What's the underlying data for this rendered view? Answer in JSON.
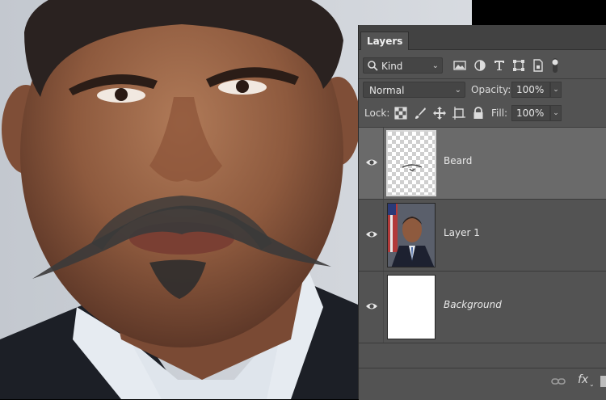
{
  "panel": {
    "tab_label": "Layers",
    "filter": {
      "value": "Kind",
      "icon": "search-icon"
    },
    "filter_icons": [
      "image-filter-icon",
      "adjustment-filter-icon",
      "type-filter-icon",
      "shape-filter-icon",
      "smart-object-filter-icon",
      "toggle-filter-icon"
    ],
    "blend_mode": "Normal",
    "opacity_label": "Opacity:",
    "opacity_value": "100%",
    "lock_label": "Lock:",
    "lock_icons": [
      "lock-transparent-icon",
      "lock-paint-icon",
      "lock-position-icon",
      "lock-artboard-icon",
      "lock-all-icon"
    ],
    "fill_label": "Fill:",
    "fill_value": "100%"
  },
  "layers": [
    {
      "name": "Beard",
      "selected": true,
      "visible": true,
      "italic": false,
      "thumb": "transparent-beard"
    },
    {
      "name": "Layer 1",
      "selected": false,
      "visible": true,
      "italic": false,
      "thumb": "portrait"
    },
    {
      "name": "Background",
      "selected": false,
      "visible": true,
      "italic": true,
      "thumb": "white"
    }
  ],
  "bottom_bar": {
    "icons": [
      "link-layers-icon",
      "fx-icon"
    ],
    "fx_label": "fx"
  },
  "colors": {
    "panel_bg": "#535353",
    "selected_row": "#6a6a6a",
    "header_bg": "#424242"
  }
}
